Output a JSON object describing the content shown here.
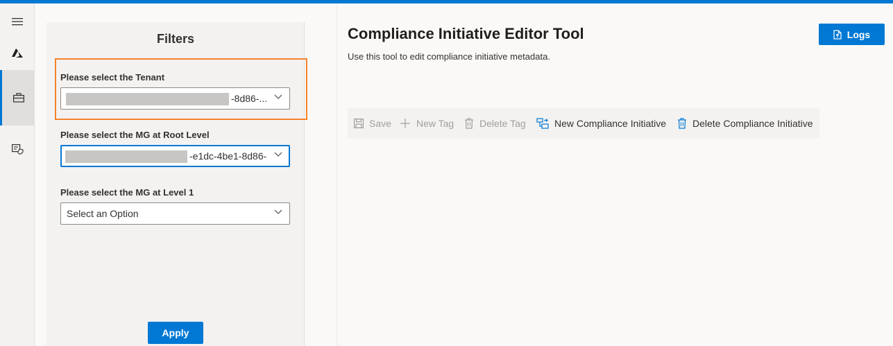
{
  "filters": {
    "title": "Filters",
    "tenant_label": "Please select the Tenant",
    "tenant_value": "-8d86-...",
    "mg_root_label": "Please select the MG at Root Level",
    "mg_root_value": "-e1dc-4be1-8d86-",
    "mg_level1_label": "Please select the MG at Level 1",
    "mg_level1_placeholder": "Select an Option",
    "apply_label": "Apply"
  },
  "header": {
    "title": "Compliance Initiative Editor Tool",
    "subtitle": "Use this tool to edit compliance initiative metadata.",
    "logs_label": "Logs"
  },
  "toolbar": {
    "save_label": "Save",
    "new_tag_label": "New Tag",
    "delete_tag_label": "Delete Tag",
    "new_initiative_label": "New Compliance Initiative",
    "delete_initiative_label": "Delete Compliance Initiative"
  },
  "rail": {
    "items": [
      "hamburger-icon",
      "azure-logo-icon",
      "briefcase-icon",
      "policy-icon"
    ]
  },
  "colors": {
    "accent": "#0078d4",
    "highlight": "#f5832a",
    "panel": "#f3f2f1"
  }
}
